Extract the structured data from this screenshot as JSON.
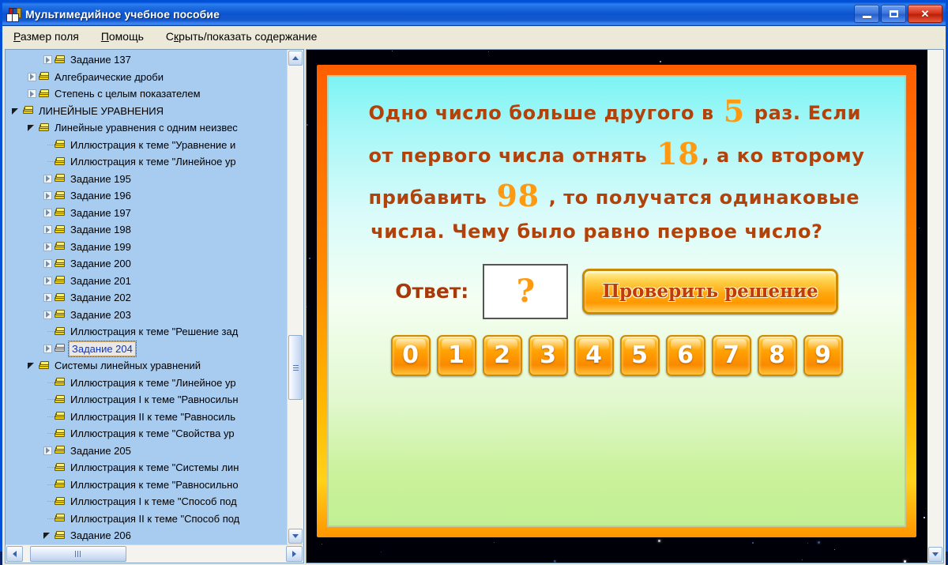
{
  "window": {
    "title": "Мультимедийное учебное пособие",
    "icon": "book-icon",
    "buttons": {
      "minimize": "minimize-icon",
      "maximize": "maximize-icon",
      "close": "✕"
    }
  },
  "menu": {
    "items": [
      {
        "prefix": "",
        "accel": "Р",
        "suffix": "азмер поля"
      },
      {
        "prefix": "",
        "accel": "П",
        "suffix": "омощь"
      },
      {
        "prefix": "С",
        "accel": "к",
        "suffix": "рыть/показать содержание"
      }
    ]
  },
  "tree": {
    "items": [
      {
        "depth": 3,
        "expander": "closed",
        "label": "Задание 137",
        "selected": false
      },
      {
        "depth": 2,
        "expander": "closed",
        "label": "Алгебраические дроби",
        "selected": false
      },
      {
        "depth": 2,
        "expander": "closed",
        "label": "Степень с целым показателем",
        "selected": false
      },
      {
        "depth": 1,
        "expander": "open",
        "label": "ЛИНЕЙНЫЕ УРАВНЕНИЯ",
        "selected": false
      },
      {
        "depth": 2,
        "expander": "open",
        "label": "Линейные уравнения с одним неизвес",
        "selected": false
      },
      {
        "depth": 3,
        "expander": "none",
        "label": "Иллюстрация к теме \"Уравнение и",
        "selected": false
      },
      {
        "depth": 3,
        "expander": "none",
        "label": "Иллюстрация к теме \"Линейное ур",
        "selected": false
      },
      {
        "depth": 3,
        "expander": "closed",
        "label": "Задание 195",
        "selected": false
      },
      {
        "depth": 3,
        "expander": "closed",
        "label": "Задание 196",
        "selected": false
      },
      {
        "depth": 3,
        "expander": "closed",
        "label": "Задание 197",
        "selected": false
      },
      {
        "depth": 3,
        "expander": "closed",
        "label": "Задание 198",
        "selected": false
      },
      {
        "depth": 3,
        "expander": "closed",
        "label": "Задание 199",
        "selected": false
      },
      {
        "depth": 3,
        "expander": "closed",
        "label": "Задание 200",
        "selected": false
      },
      {
        "depth": 3,
        "expander": "closed",
        "label": "Задание 201",
        "selected": false
      },
      {
        "depth": 3,
        "expander": "closed",
        "label": "Задание 202",
        "selected": false
      },
      {
        "depth": 3,
        "expander": "closed",
        "label": "Задание 203",
        "selected": false
      },
      {
        "depth": 3,
        "expander": "none",
        "label": "Иллюстрация к теме \"Решение зад",
        "selected": false
      },
      {
        "depth": 3,
        "expander": "closed",
        "label": "Задание 204",
        "selected": true
      },
      {
        "depth": 2,
        "expander": "open",
        "label": "Системы линейных уравнений",
        "selected": false
      },
      {
        "depth": 3,
        "expander": "none",
        "label": "Иллюстрация к теме \"Линейное ур",
        "selected": false
      },
      {
        "depth": 3,
        "expander": "none",
        "label": "Иллюстрация I к теме \"Равносильн",
        "selected": false
      },
      {
        "depth": 3,
        "expander": "none",
        "label": "Иллюстрация II к теме \"Равносиль",
        "selected": false
      },
      {
        "depth": 3,
        "expander": "none",
        "label": "Иллюстрация к теме \"Свойства ур",
        "selected": false
      },
      {
        "depth": 3,
        "expander": "closed",
        "label": "Задание 205",
        "selected": false
      },
      {
        "depth": 3,
        "expander": "none",
        "label": "Иллюстрация к теме \"Системы лин",
        "selected": false
      },
      {
        "depth": 3,
        "expander": "none",
        "label": "Иллюстрация к теме \"Равносильно",
        "selected": false
      },
      {
        "depth": 3,
        "expander": "none",
        "label": "Иллюстрация I к теме \"Способ под",
        "selected": false
      },
      {
        "depth": 3,
        "expander": "none",
        "label": "Иллюстрация II к теме \"Способ под",
        "selected": false
      },
      {
        "depth": 3,
        "expander": "open",
        "label": "Задание 206",
        "selected": false
      }
    ],
    "scroll_up_icon": "scroll-up-arrow",
    "scroll_down_icon": "scroll-down-arrow",
    "scroll_left_icon": "scroll-left-arrow",
    "scroll_right_icon": "scroll-right-arrow"
  },
  "lesson": {
    "question_lines": [
      [
        {
          "t": "Одно  число  больше  другого  в ",
          "k": "w"
        },
        {
          "t": "5",
          "k": "n"
        },
        {
          "t": " раз.  Если",
          "k": "w"
        }
      ],
      [
        {
          "t": "от  первого  числа  отнять  ",
          "k": "w"
        },
        {
          "t": "18",
          "k": "n"
        },
        {
          "t": ",  а  ко  второму",
          "k": "w"
        }
      ],
      [
        {
          "t": "прибавить  ",
          "k": "w"
        },
        {
          "t": "98",
          "k": "n"
        },
        {
          "t": " ,  то  получатся  одинаковые",
          "k": "w"
        }
      ],
      [
        {
          "t": "числа.  Чему  было  равно  первое  число?",
          "k": "w"
        }
      ]
    ],
    "answer_label": "Ответ:",
    "answer_value": "?",
    "check_button": "Проверить решение",
    "digits": [
      "0",
      "1",
      "2",
      "3",
      "4",
      "5",
      "6",
      "7",
      "8",
      "9"
    ]
  },
  "colors": {
    "title_bar": "#1f6fe4",
    "menu_bar": "#ece9d8",
    "tree_bg": "#a8cbf0",
    "frame_orange": "#ff7000",
    "frame_yellow": "#ffd21a",
    "question_text": "#b3420a",
    "question_number": "#ff9a10",
    "digit_button": "#ff9d00",
    "stage_bg": "#000008"
  }
}
